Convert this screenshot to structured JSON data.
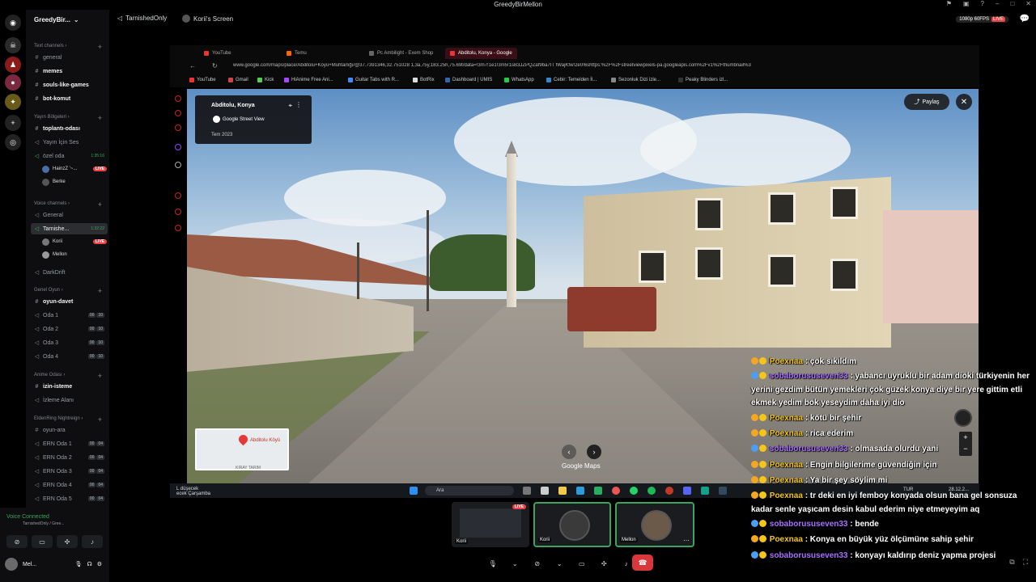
{
  "titlebar": {
    "title": "GreedyBirMellon"
  },
  "guild": {
    "name": "GreedyBir..."
  },
  "categories": {
    "text": "Text channels",
    "yayin": "Yayın Bölgeleri",
    "voice": "Voice channels",
    "genel_oyun": "Genel Oyun",
    "anime": "Anime Odası",
    "eldenring": "EldenRing Nightreign"
  },
  "channels": {
    "general": "general",
    "memes": "memes",
    "souls": "souls-like-games",
    "botkomut": "bot-komut",
    "toplanti": "toplantı-odası",
    "yayin_icin": "Yayın İçin Ses",
    "ozel": "özel oda",
    "ozel_time": "1:35:16",
    "user_hainz": "HainzZ '~...",
    "user_berke": "Berke",
    "v_general": "General",
    "tarnished": "Tarnishe...",
    "tarnished_time": "1:32:22",
    "user_korii": "Korii",
    "user_mellon": "Mellon",
    "darkdrift": "DarkDrift",
    "oyun_davet": "oyun-davet",
    "oda1": "Oda 1",
    "oda2": "Oda 2",
    "oda3": "Oda 3",
    "oda4": "Oda 4",
    "oda_cnt_a": "00",
    "oda_cnt_b": "10",
    "izin": "izin-isteme",
    "izleme": "İzleme Alanı",
    "oyun_ara": "oyun-ara",
    "ern1": "ERN Oda 1",
    "ern2": "ERN Oda 2",
    "ern3": "ERN Oda 3",
    "ern4": "ERN Oda 4",
    "ern5": "ERN Oda 5",
    "ern_cnt_a": "00",
    "ern_cnt_b": "04",
    "live": "LIVE"
  },
  "voice_panel": {
    "status": "Voice Connected",
    "sub": "TarnishedOnly / Gree...",
    "user": "Mel..."
  },
  "stream_header": {
    "channel": "TarnishedOnly",
    "screen": "Korii's Screen",
    "quality": "1080p 60FPS",
    "live": "LIVE"
  },
  "browser": {
    "tabs": [
      "YouTube",
      "Temu",
      "Pc Ambilight - Exem Shop",
      "Abditolu, Konya - Google"
    ],
    "url": "www.google.com/maps/place/Abditolu+Köyü+Muhtarlığı/@37.7391346,32.751028 1,3a,75y,183.25h,75.69t/data=!3m7!1e1!3m5!1sB3JZPQZaf9ba7IT fWajKfw!2e0!6shttps:%2F%2Fstreetviewpixels-pa.googleapis.com%2Fv1%2Fthumbnail%3",
    "bookmarks": [
      "YouTube",
      "Gmail",
      "Kick",
      "HiAnime Free Ani...",
      "Guitar Tabs with R...",
      "BotRix",
      "Dashboard | UMIS",
      "WhatsApp",
      "Cebir: Temelden İl...",
      "Sezonluk Dizi izle...",
      "Peaky Blinders izl..."
    ]
  },
  "streetview": {
    "place": "Abditolu, Konya",
    "sv_label": "Google Street View",
    "date": "Tem 2023",
    "share": "Paylaş",
    "minimap_label": "Abditolu Köyü",
    "minimap_sub": "KIRAY TARIM",
    "brand": "Google Maps"
  },
  "taskbar": {
    "search": "Ara",
    "time": "28.12.2...",
    "lang": "TUR",
    "weather1": "L düşecek",
    "weather2": "ecek Çarşamba"
  },
  "chat": [
    {
      "user": "Poexnaa",
      "text": " : çok sıkıldım",
      "color": "#f5c518"
    },
    {
      "user": "sobaborususeven33",
      "text": " : yabancı uyruklu bir adam dioki türkiyenin her yerini gezdim bütün yemekleri çok güzek konya diye bir yere gittim etli ekmek yedim bok yeseydim daha iyi dio",
      "color": "#a970ff"
    },
    {
      "user": "Poexnaa",
      "text": " : kötü bir şehir",
      "color": "#f5c518"
    },
    {
      "user": "Poexnaa",
      "text": " : rica ederim",
      "color": "#f5c518"
    },
    {
      "user": "sobaborususeven33",
      "text": " : olmasada olurdu yani",
      "color": "#a970ff"
    },
    {
      "user": "Poexnaa",
      "text": " : Engin bilgilerime güvendiğin için",
      "color": "#f5c518"
    },
    {
      "user": "Poexnaa",
      "text": " : Ya bir şey söylim mi",
      "color": "#f5c518"
    },
    {
      "user": "Poexnaa",
      "text": " : tr deki en iyi femboy konyada olsun bana gel sonsuza kadar senle yaşıcam desin kabul ederim niye etmeyeyim aq",
      "color": "#f5c518"
    },
    {
      "user": "sobaborususeven33",
      "text": " : bende",
      "color": "#a970ff"
    },
    {
      "user": "Poexnaa",
      "text": " : Konya en büyük yüz ölçümüne sahip şehir",
      "color": "#f5c518"
    },
    {
      "user": "sobaborususeven33",
      "text": " : konyayı kaldırıp deniz yapma projesi",
      "color": "#a970ff"
    }
  ],
  "participants": [
    {
      "name": "Korii",
      "live": "LIVE"
    },
    {
      "name": "Korii"
    },
    {
      "name": "Mellon"
    }
  ]
}
